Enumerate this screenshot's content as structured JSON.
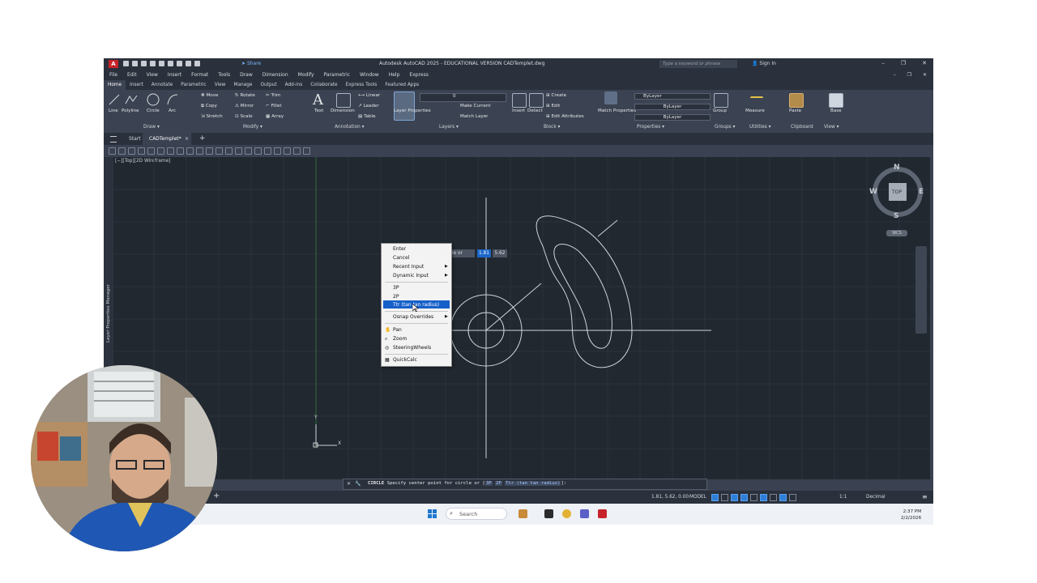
{
  "window": {
    "title": "Autodesk AutoCAD 2025 - EDUCATIONAL VERSION   CADTemplet.dwg",
    "logo": "A",
    "share_label": "Share",
    "search_placeholder": "Type a keyword or phrase",
    "sign_in": "Sign In"
  },
  "menubar": [
    "File",
    "Edit",
    "View",
    "Insert",
    "Format",
    "Tools",
    "Draw",
    "Dimension",
    "Modify",
    "Parametric",
    "Window",
    "Help",
    "Express"
  ],
  "ribbon_tabs": [
    "Home",
    "Insert",
    "Annotate",
    "Parametric",
    "View",
    "Manage",
    "Output",
    "Add-ins",
    "Collaborate",
    "Express Tools",
    "Featured Apps"
  ],
  "ribbon": {
    "draw": {
      "line": "Line",
      "polyline": "Polyline",
      "circle": "Circle",
      "arc": "Arc",
      "panel": "Draw ▾"
    },
    "modify": {
      "move": "Move",
      "rotate": "Rotate",
      "trim": "Trim",
      "copy": "Copy",
      "mirror": "Mirror",
      "fillet": "Fillet",
      "stretch": "Stretch",
      "scale": "Scale",
      "array": "Array",
      "panel": "Modify ▾"
    },
    "annotation": {
      "text": "Text",
      "dimension": "Dimension",
      "linear": "Linear",
      "leader": "Leader",
      "table": "Table",
      "panel": "Annotation ▾"
    },
    "layers": {
      "layer_properties": "Layer Properties",
      "layer_value": "0",
      "make_current": "Make Current",
      "match_layer": "Match Layer",
      "panel": "Layers ▾"
    },
    "block": {
      "insert": "Insert",
      "detect": "Detect",
      "create": "Create",
      "edit": "Edit",
      "edit_attributes": "Edit Attributes",
      "panel": "Block ▾"
    },
    "properties": {
      "match": "Match Properties",
      "bylayer1": "ByLayer",
      "bylayer2": "ByLayer",
      "bylayer3": "ByLayer",
      "panel": "Properties ▾"
    },
    "groups": {
      "group": "Group",
      "panel": "Groups ▾"
    },
    "utilities": {
      "measure": "Measure",
      "panel": "Utilities ▾"
    },
    "clipboard": {
      "paste": "Paste",
      "panel": "Clipboard"
    },
    "view": {
      "base": "Base",
      "panel": "View ▾"
    }
  },
  "doc_tabs": {
    "start": "Start",
    "active": "CADTemplet*",
    "close": "×",
    "add": "+"
  },
  "viewport": {
    "label": "[−][Top][2D Wireframe]",
    "sidebar_label": "Layer Properties Manager",
    "ucs_y": "Y",
    "ucs_x": "X"
  },
  "viewcube": {
    "n": "N",
    "s": "S",
    "e": "E",
    "w": "W",
    "top": "TOP",
    "wcs": "WCS"
  },
  "context_menu": {
    "items": [
      "Enter",
      "Cancel",
      "Recent Input",
      "Dynamic Input",
      "3P",
      "2P",
      "Ttr (tan tan radius)",
      "Osnap Overrides",
      "Pan",
      "Zoom",
      "SteeringWheels",
      "QuickCalc"
    ]
  },
  "dynamic_input": {
    "prompt": "le or",
    "value1": "1.81",
    "value2": "5.62"
  },
  "command_line": {
    "command": "CIRCLE",
    "prompt": "Specify center point for circle or [",
    "opt1": "3P",
    "opt2": "2P",
    "opt3": "Ttr (tan tan radius)",
    "end": "]:"
  },
  "status_bar": {
    "coords": "1.81, 5.62, 0.00",
    "model": "MODEL",
    "scale": "1:1",
    "units": "Decimal"
  },
  "taskbar": {
    "search": "Search",
    "time": "2:37 PM",
    "date": "2/2/2026"
  }
}
